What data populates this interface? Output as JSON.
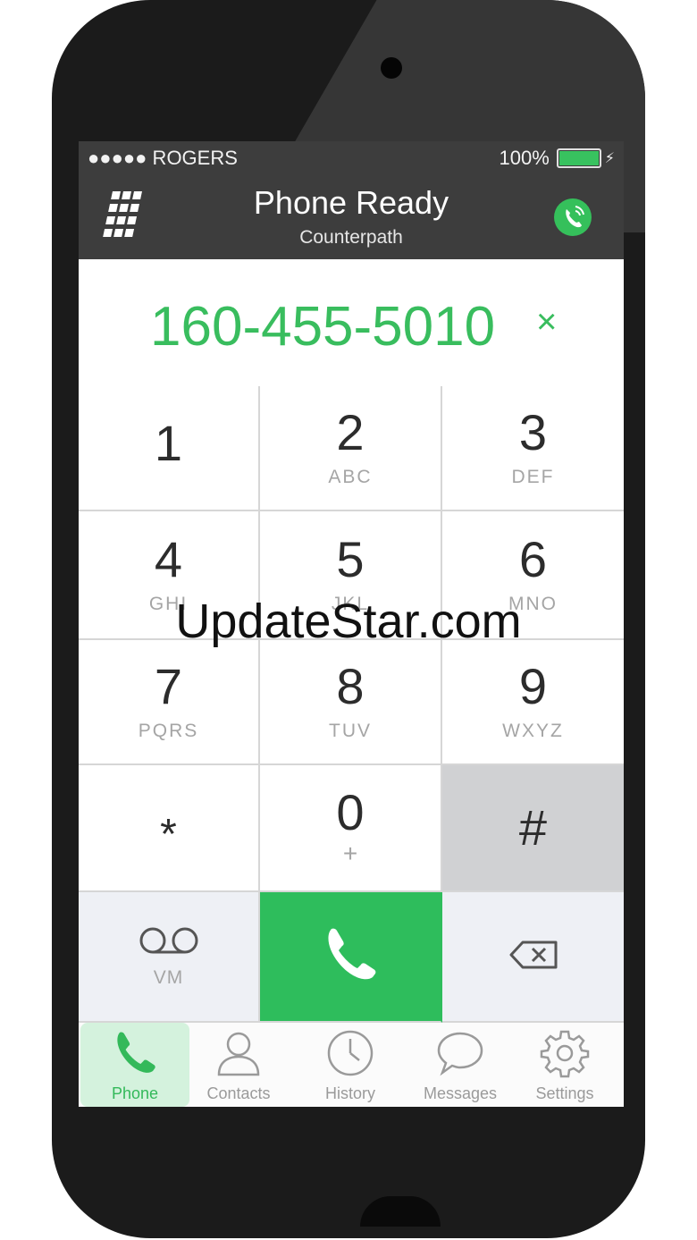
{
  "status_bar": {
    "carrier": "●●●●● ROGERS",
    "battery": "100%"
  },
  "header": {
    "title": "Phone Ready",
    "subtitle": "Counterpath"
  },
  "dialer": {
    "number": "160-455-5010",
    "clear_glyph": "×"
  },
  "keys": [
    {
      "digit": "1",
      "letters": ""
    },
    {
      "digit": "2",
      "letters": "ABC"
    },
    {
      "digit": "3",
      "letters": "DEF"
    },
    {
      "digit": "4",
      "letters": "GHI"
    },
    {
      "digit": "5",
      "letters": "JKL"
    },
    {
      "digit": "6",
      "letters": "MNO"
    },
    {
      "digit": "7",
      "letters": "PQRS"
    },
    {
      "digit": "8",
      "letters": "TUV"
    },
    {
      "digit": "9",
      "letters": "WXYZ"
    },
    {
      "digit": "*",
      "letters": ""
    },
    {
      "digit": "0",
      "letters": "+"
    },
    {
      "digit": "#",
      "letters": ""
    }
  ],
  "actions": {
    "voicemail_label": "VM"
  },
  "tabs": [
    {
      "label": "Phone",
      "icon": "phone-icon",
      "active": true
    },
    {
      "label": "Contacts",
      "icon": "contacts-icon",
      "active": false
    },
    {
      "label": "History",
      "icon": "clock-icon",
      "active": false
    },
    {
      "label": "Messages",
      "icon": "speech-bubble-icon",
      "active": false
    },
    {
      "label": "Settings",
      "icon": "gear-icon",
      "active": false
    }
  ],
  "watermark": "UpdateStar.com",
  "colors": {
    "accent": "#39bd5e",
    "header_bg": "#3d3d3d",
    "call_button": "#2ebd5c",
    "pressed_key": "#d0d1d3"
  }
}
